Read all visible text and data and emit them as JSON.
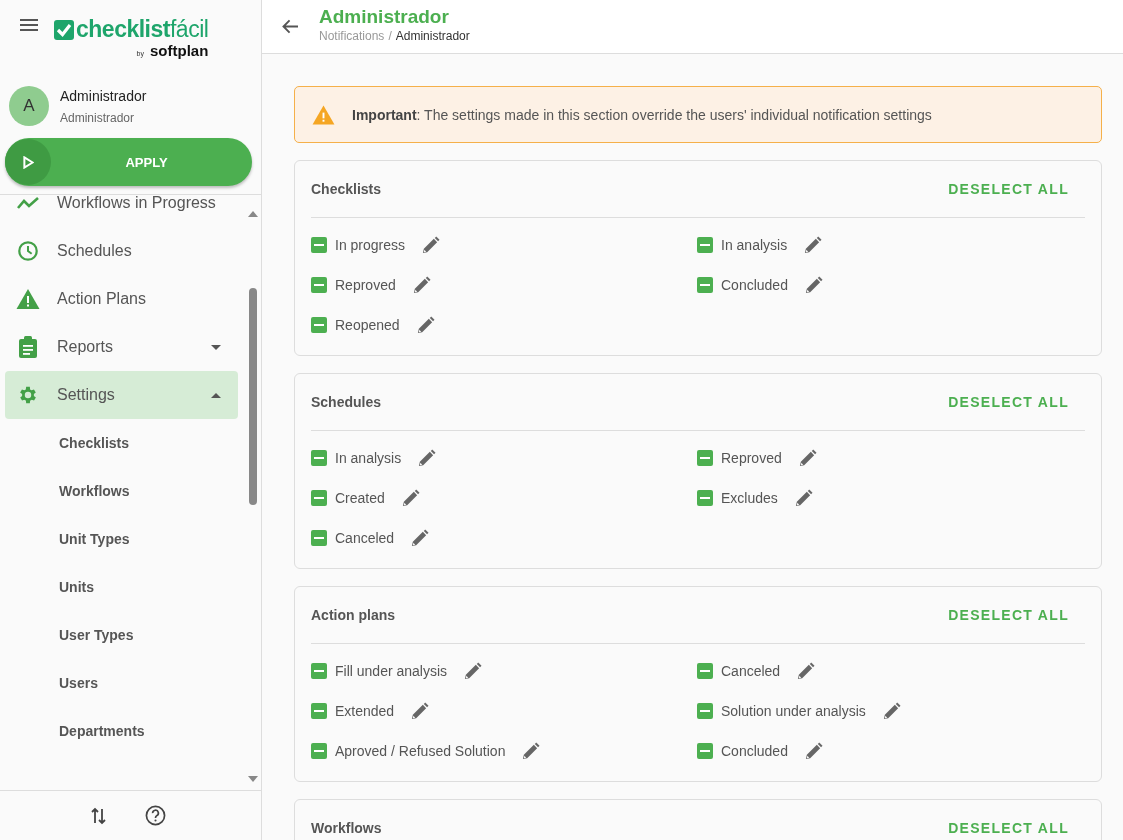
{
  "sidebar": {
    "logo": {
      "brand": "**checklist**fácil",
      "by": "by",
      "company": "softplan"
    },
    "user": {
      "initial": "A",
      "name": "Administrador",
      "role": "Administrador"
    },
    "apply_button": "APPLY",
    "menu": [
      {
        "label": "Workflows in Progress",
        "selected": false
      },
      {
        "label": "Schedules",
        "selected": false
      },
      {
        "label": "Action Plans",
        "selected": false
      },
      {
        "label": "Reports",
        "selected": false,
        "expanded": false
      },
      {
        "label": "Settings",
        "selected": true,
        "expanded": true,
        "children": [
          {
            "label": "Checklists"
          },
          {
            "label": "Workflows"
          },
          {
            "label": "Unit Types"
          },
          {
            "label": "Units"
          },
          {
            "label": "User Types"
          },
          {
            "label": "Users"
          },
          {
            "label": "Departments"
          }
        ]
      }
    ]
  },
  "header": {
    "title": "Administrador",
    "breadcrumb": {
      "parent": "Notifications",
      "separator": "/",
      "current": "Administrador"
    }
  },
  "alert": {
    "text": "**Important**: The settings made in this section override the users' individual notification settings"
  },
  "sections": [
    {
      "title": "Checklists",
      "action": "DESELECT ALL",
      "items": [
        {
          "label": "In progress",
          "indeterminate": true
        },
        {
          "label": "In analysis",
          "indeterminate": true
        },
        {
          "label": "Reproved",
          "indeterminate": true
        },
        {
          "label": "Concluded",
          "indeterminate": true
        },
        {
          "label": "Reopened",
          "indeterminate": true
        }
      ]
    },
    {
      "title": "Schedules",
      "action": "DESELECT ALL",
      "items": [
        {
          "label": "In analysis",
          "indeterminate": true
        },
        {
          "label": "Reproved",
          "indeterminate": true
        },
        {
          "label": "Created",
          "indeterminate": true
        },
        {
          "label": "Excludes",
          "indeterminate": true
        },
        {
          "label": "Canceled",
          "indeterminate": true
        }
      ]
    },
    {
      "title": "Action plans",
      "action": "DESELECT ALL",
      "items": [
        {
          "label": "Fill under analysis",
          "indeterminate": true
        },
        {
          "label": "Canceled",
          "indeterminate": true
        },
        {
          "label": "Extended",
          "indeterminate": true
        },
        {
          "label": "Solution under analysis",
          "indeterminate": true
        },
        {
          "label": "Aproved / Refused Solution",
          "indeterminate": true
        },
        {
          "label": "Concluded",
          "indeterminate": true
        }
      ]
    },
    {
      "title": "Workflows",
      "action": "DESELECT ALL"
    }
  ]
}
